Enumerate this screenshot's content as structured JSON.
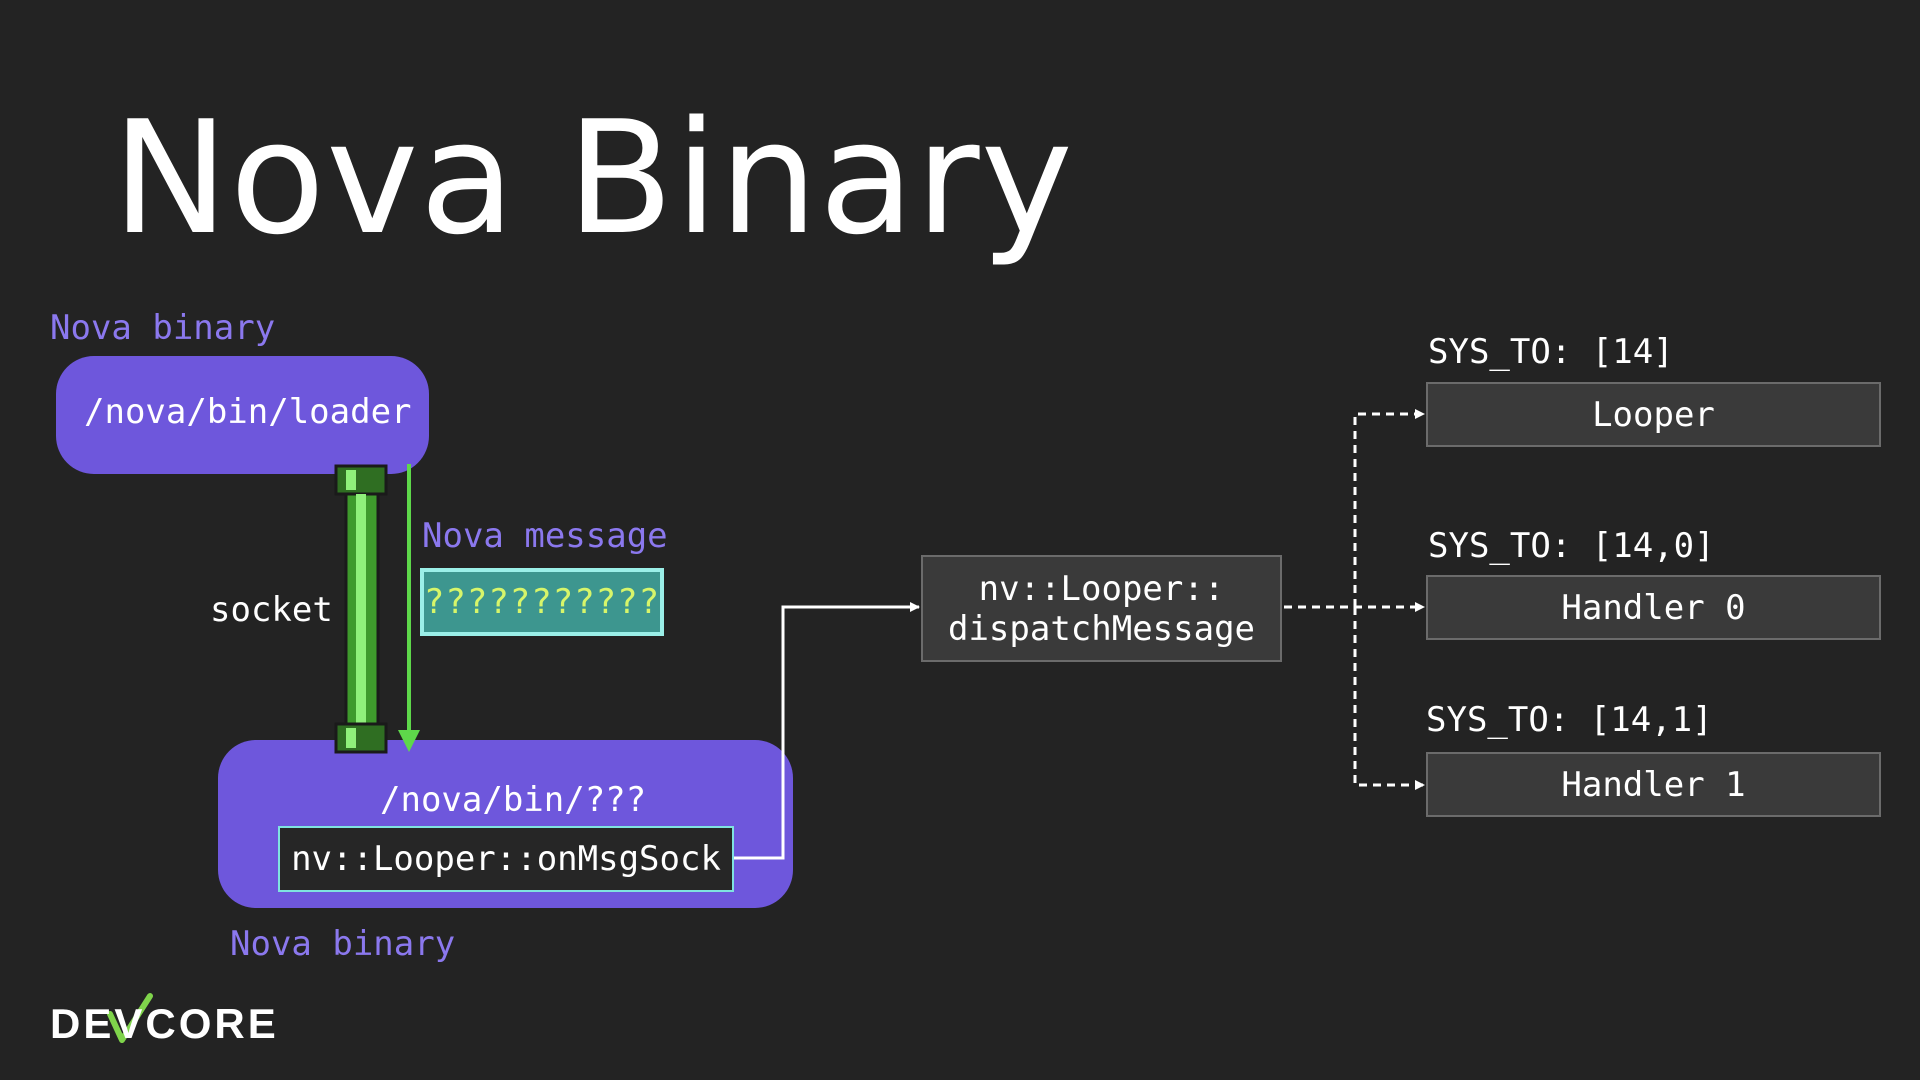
{
  "slide": {
    "title": "Nova Binary"
  },
  "source": {
    "caption": "Nova binary",
    "path": "/nova/bin/loader"
  },
  "channel": {
    "label": "socket",
    "message_label": "Nova message",
    "message_content": "???????????"
  },
  "target": {
    "path": "/nova/bin/???",
    "function": "nv::Looper::onMsgSock",
    "caption": "Nova binary"
  },
  "dispatcher": {
    "line1": "nv::Looper::",
    "line2": "dispatchMessage"
  },
  "handlers": [
    {
      "sys_to": "SYS_TO: [14]",
      "name": "Looper"
    },
    {
      "sys_to": "SYS_TO: [14,0]",
      "name": "Handler 0"
    },
    {
      "sys_to": "SYS_TO: [14,1]",
      "name": "Handler 1"
    }
  ],
  "brand": {
    "logo_text": "DEVCORE"
  },
  "colors": {
    "background": "#232323",
    "accent_purple": "#6e57dc",
    "caption_purple": "#8b78ee",
    "pipe_green": "#5ed84a",
    "message_teal": "#3d968f",
    "message_text": "#d7f56a"
  }
}
